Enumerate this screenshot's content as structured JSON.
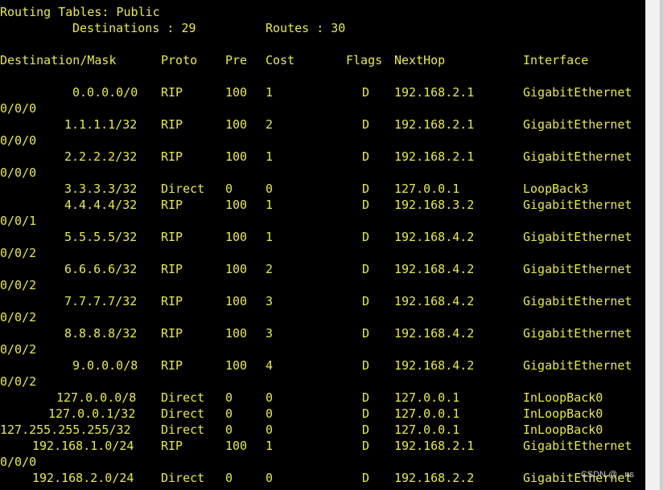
{
  "header": {
    "title": "Routing Tables: Public",
    "destinations_label": "Destinations : 29",
    "routes_label": "Routes : 30"
  },
  "columns": [
    "Destination/Mask",
    "Proto",
    "Pre",
    "Cost",
    "Flags",
    "NextHop",
    "Interface"
  ],
  "routes": [
    {
      "dest": "0.0.0.0/0",
      "proto": "RIP",
      "pre": "100",
      "cost": "1",
      "flags": "D",
      "nexthop": "192.168.2.1",
      "iface": "GigabitEthernet",
      "iface_cont": "0/0/0"
    },
    {
      "dest": "1.1.1.1/32",
      "proto": "RIP",
      "pre": "100",
      "cost": "2",
      "flags": "D",
      "nexthop": "192.168.2.1",
      "iface": "GigabitEthernet",
      "iface_cont": "0/0/0"
    },
    {
      "dest": "2.2.2.2/32",
      "proto": "RIP",
      "pre": "100",
      "cost": "1",
      "flags": "D",
      "nexthop": "192.168.2.1",
      "iface": "GigabitEthernet",
      "iface_cont": "0/0/0"
    },
    {
      "dest": "3.3.3.3/32",
      "proto": "Direct",
      "pre": "0",
      "cost": "0",
      "flags": "D",
      "nexthop": "127.0.0.1",
      "iface": "LoopBack3",
      "iface_cont": ""
    },
    {
      "dest": "4.4.4.4/32",
      "proto": "RIP",
      "pre": "100",
      "cost": "1",
      "flags": "D",
      "nexthop": "192.168.3.2",
      "iface": "GigabitEthernet",
      "iface_cont": "0/0/1"
    },
    {
      "dest": "5.5.5.5/32",
      "proto": "RIP",
      "pre": "100",
      "cost": "1",
      "flags": "D",
      "nexthop": "192.168.4.2",
      "iface": "GigabitEthernet",
      "iface_cont": "0/0/2"
    },
    {
      "dest": "6.6.6.6/32",
      "proto": "RIP",
      "pre": "100",
      "cost": "2",
      "flags": "D",
      "nexthop": "192.168.4.2",
      "iface": "GigabitEthernet",
      "iface_cont": "0/0/2"
    },
    {
      "dest": "7.7.7.7/32",
      "proto": "RIP",
      "pre": "100",
      "cost": "3",
      "flags": "D",
      "nexthop": "192.168.4.2",
      "iface": "GigabitEthernet",
      "iface_cont": "0/0/2"
    },
    {
      "dest": "8.8.8.8/32",
      "proto": "RIP",
      "pre": "100",
      "cost": "3",
      "flags": "D",
      "nexthop": "192.168.4.2",
      "iface": "GigabitEthernet",
      "iface_cont": "0/0/2"
    },
    {
      "dest": "9.0.0.0/8",
      "proto": "RIP",
      "pre": "100",
      "cost": "4",
      "flags": "D",
      "nexthop": "192.168.4.2",
      "iface": "GigabitEthernet",
      "iface_cont": "0/0/2"
    },
    {
      "dest": "127.0.0.0/8",
      "proto": "Direct",
      "pre": "0",
      "cost": "0",
      "flags": "D",
      "nexthop": "127.0.0.1",
      "iface": "InLoopBack0",
      "iface_cont": ""
    },
    {
      "dest": "127.0.0.1/32",
      "proto": "Direct",
      "pre": "0",
      "cost": "0",
      "flags": "D",
      "nexthop": "127.0.0.1",
      "iface": "InLoopBack0",
      "iface_cont": ""
    },
    {
      "dest": "127.255.255.255/32",
      "proto": "Direct",
      "pre": "0",
      "cost": "0",
      "flags": "D",
      "nexthop": "127.0.0.1",
      "iface": "InLoopBack0",
      "iface_cont": ""
    },
    {
      "dest": "192.168.1.0/24",
      "proto": "RIP",
      "pre": "100",
      "cost": "1",
      "flags": "D",
      "nexthop": "192.168.2.1",
      "iface": "GigabitEthernet",
      "iface_cont": "0/0/0"
    },
    {
      "dest": "192.168.2.0/24",
      "proto": "Direct",
      "pre": "0",
      "cost": "0",
      "flags": "D",
      "nexthop": "192.168.2.2",
      "iface": "GigabitEthernet",
      "iface_cont": ""
    }
  ],
  "watermark": "CSDN @...ns",
  "colors": {
    "background": "#000000",
    "text": "#e8e84a"
  }
}
